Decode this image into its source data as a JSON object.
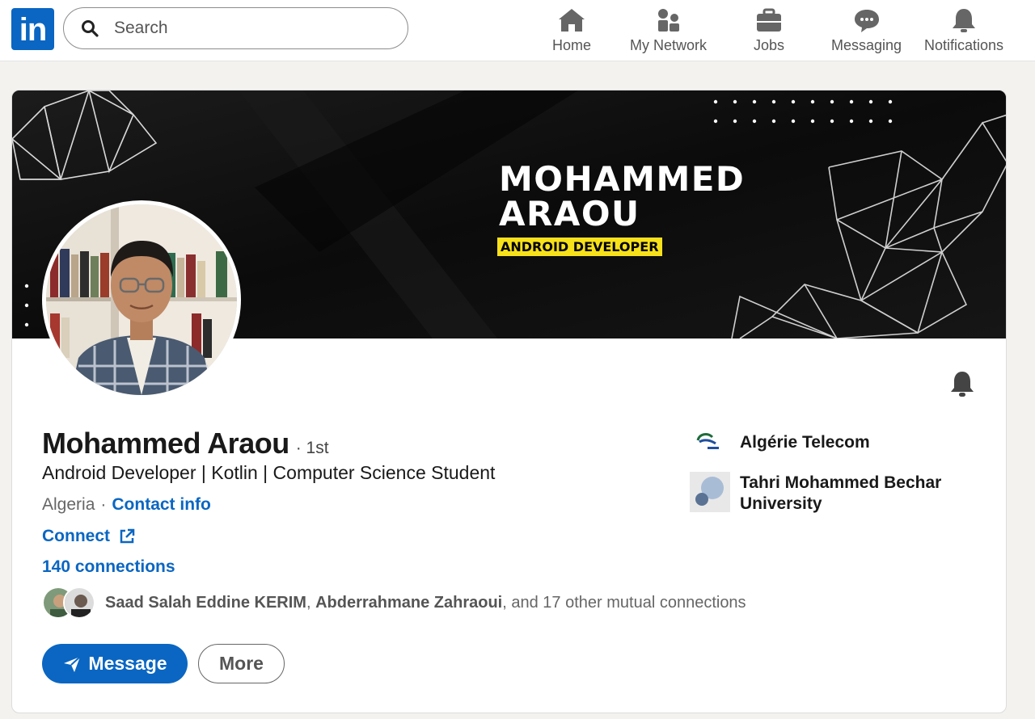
{
  "topbar": {
    "logo_text": "in",
    "search_placeholder": "Search",
    "nav": [
      {
        "label": "Home",
        "icon": "home-icon"
      },
      {
        "label": "My Network",
        "icon": "network-icon"
      },
      {
        "label": "Jobs",
        "icon": "briefcase-icon"
      },
      {
        "label": "Messaging",
        "icon": "chat-icon"
      },
      {
        "label": "Notifications",
        "icon": "bell-icon"
      }
    ]
  },
  "banner": {
    "name_line1": "MOHAMMED",
    "name_line2": "ARAOU",
    "tagline": "ANDROID DEVELOPER"
  },
  "profile": {
    "name": "Mohammed Araou",
    "degree": "· 1st",
    "headline": "Android Developer | Kotlin | Computer Science Student",
    "location": "Algeria",
    "separator": "·",
    "contact_info": "Contact info",
    "connect": "Connect",
    "connections": "140 connections",
    "mutual": {
      "name1": "Saad Salah Eddine KERIM",
      "name2": "Abderrahmane Zahraoui",
      "rest": ", and 17 other mutual connections"
    },
    "actions": {
      "message": "Message",
      "more": "More"
    },
    "orgs": [
      {
        "name": "Algérie Telecom"
      },
      {
        "name": "Tahri Mohammed Bechar University"
      }
    ]
  },
  "colors": {
    "brand": "#0a66c2",
    "banner_bg": "#0e0e0e",
    "tag_yellow": "#f7e11b",
    "page_bg": "#f3f2ef"
  }
}
